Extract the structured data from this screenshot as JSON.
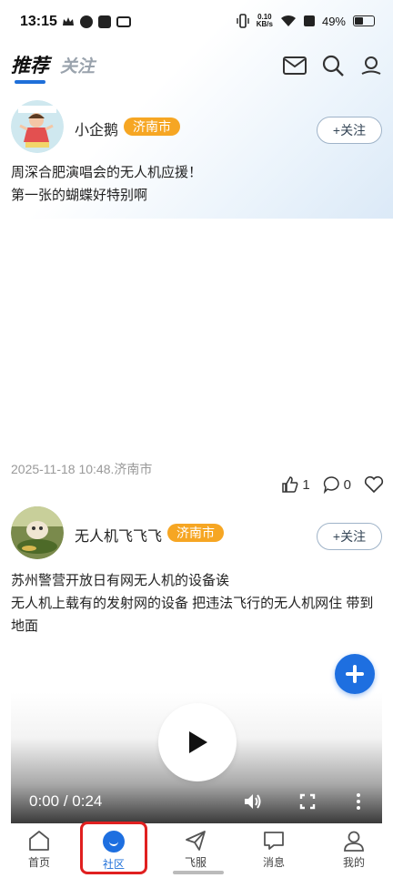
{
  "status_bar": {
    "time": "13:15",
    "net_speed_top": "0.10",
    "net_speed_bottom": "KB/s",
    "battery": "49%",
    "battery_level": 0.49
  },
  "header": {
    "tab_recommend": "推荐",
    "tab_follow": "关注",
    "icons": [
      "mail-icon",
      "search-icon",
      "profile-icon"
    ]
  },
  "posts": [
    {
      "username": "小企鹅",
      "location_badge": "济南市",
      "follow_label": "+关注",
      "text_lines": [
        "周深合肥演唱会的无人机应援！",
        "第一张的蝴蝶好特别啊"
      ],
      "meta": "2025-11-18 10:48.济南市",
      "likes": "1",
      "comments": "0"
    },
    {
      "username": "无人机飞飞飞",
      "location_badge": "济南市",
      "follow_label": "+关注",
      "text_lines": [
        "苏州警营开放日有网无人机的设备诶",
        "无人机上载有的发射网的设备 把违法飞行的无人机网住 带到",
        "地面"
      ],
      "video": {
        "current": "0:00",
        "separator": "/",
        "duration": "0:24"
      }
    }
  ],
  "tabbar": {
    "items": [
      {
        "label": "首页",
        "icon": "home-icon"
      },
      {
        "label": "社区",
        "icon": "community-icon",
        "active": true
      },
      {
        "label": "飞服",
        "icon": "paper-plane-icon"
      },
      {
        "label": "消息",
        "icon": "message-icon"
      },
      {
        "label": "我的",
        "icon": "user-icon"
      }
    ]
  },
  "colors": {
    "accent": "#1e6fd9",
    "badge": "#f6a623",
    "highlight": "#e02020"
  }
}
